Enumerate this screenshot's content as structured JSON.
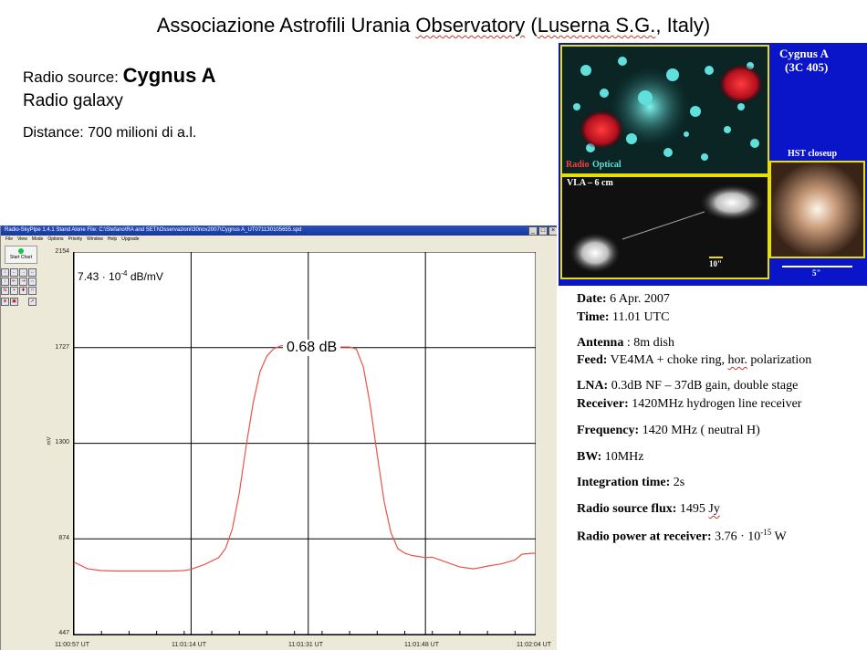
{
  "header": {
    "title_pre": "Associazione Astrofili Urania ",
    "title_obs": "Observatory",
    "title_mid": " (",
    "title_place": "Luserna S.G.",
    "title_post": ", Italy)"
  },
  "source": {
    "label": "Radio source: ",
    "name": "Cygnus A",
    "type": "Radio galaxy",
    "distance": "Distance: 700 milioni di a.l."
  },
  "skypipe": {
    "window_title": "Radio-SkyPipe 1.4.1   Stand Alone   File: C:\\Stefano\\RA and SETI\\Osservazioni\\30nov2007\\Cygnus A_UT071130105655.spd",
    "menu": [
      "File",
      "View",
      "Mode",
      "Options",
      "Priority",
      "Window",
      "Help",
      "Upgrade"
    ],
    "start_chart": "Start Chart",
    "calibration": "7.43 · 10",
    "calibration_exp": "-4",
    "calibration_unit": " dB/mV",
    "peak_label": "0.68 dB",
    "y_unit": "mV"
  },
  "chart_data": {
    "type": "line",
    "title": "",
    "xlabel": "",
    "ylabel": "mV",
    "ylim": [
      447,
      2154
    ],
    "yticks": [
      "2154",
      "1727",
      "1300",
      "874",
      "447"
    ],
    "xticks": [
      "11:00:57 UT",
      "11:01:14 UT",
      "11:01:31 UT",
      "11:01:48 UT",
      "11:02:04 UT"
    ],
    "x_seconds": [
      0,
      17,
      34,
      51,
      67
    ],
    "series": [
      {
        "color": "#e8544a",
        "x": [
          0,
          2,
          4,
          6,
          8,
          10,
          12,
          14,
          16,
          17,
          19,
          21,
          22,
          23,
          24,
          25,
          26,
          27,
          28,
          29,
          30,
          31,
          32,
          34,
          36,
          38,
          40,
          41,
          42,
          43,
          44,
          45,
          46,
          47,
          48,
          49,
          50,
          51,
          52,
          54,
          56,
          58,
          60,
          62,
          64,
          65,
          66,
          67
        ],
        "y": [
          770,
          740,
          732,
          730,
          730,
          730,
          730,
          730,
          732,
          738,
          760,
          790,
          830,
          920,
          1080,
          1290,
          1480,
          1620,
          1690,
          1722,
          1735,
          1740,
          1732,
          1730,
          1730,
          1730,
          1730,
          1720,
          1640,
          1470,
          1250,
          1040,
          900,
          830,
          810,
          800,
          795,
          790,
          792,
          770,
          748,
          740,
          752,
          762,
          780,
          805,
          808,
          810
        ]
      }
    ]
  },
  "image": {
    "object": "Cygnus A",
    "catalog": "(3C 405)",
    "radio": "Radio",
    "optical": "Optical",
    "vla": "VLA – 6 cm",
    "hst": "HST closeup",
    "scale1": "10\"",
    "scale2": "5\""
  },
  "info": {
    "date_label": "Date:",
    "date": " 6 Apr. 2007",
    "time_label": "Time:",
    "time": " 11.01 UTC",
    "antenna_label": "Antenna",
    "antenna": " : 8m dish",
    "feed_label": "Feed:",
    "feed_pre": " VE4MA + choke ring, ",
    "feed_hor": "hor.",
    "feed_post": " polarization",
    "lna_label": "LNA:",
    "lna": " 0.3dB NF – 37dB gain, double stage",
    "receiver_label": "Receiver:",
    "receiver": " 1420MHz hydrogen line receiver",
    "frequency_label": "Frequency:",
    "frequency": " 1420 MHz ( neutral H)",
    "bw_label": "BW:",
    "bw": " 10MHz",
    "integration_label": "Integration time:",
    "integration": " 2s",
    "flux_label": "Radio source flux:",
    "flux_pre": " 1495 ",
    "flux_jy": "Jy",
    "power_label": "Radio power at receiver:",
    "power": " 3.76 · 10",
    "power_exp": "-15",
    "power_unit": " W"
  }
}
